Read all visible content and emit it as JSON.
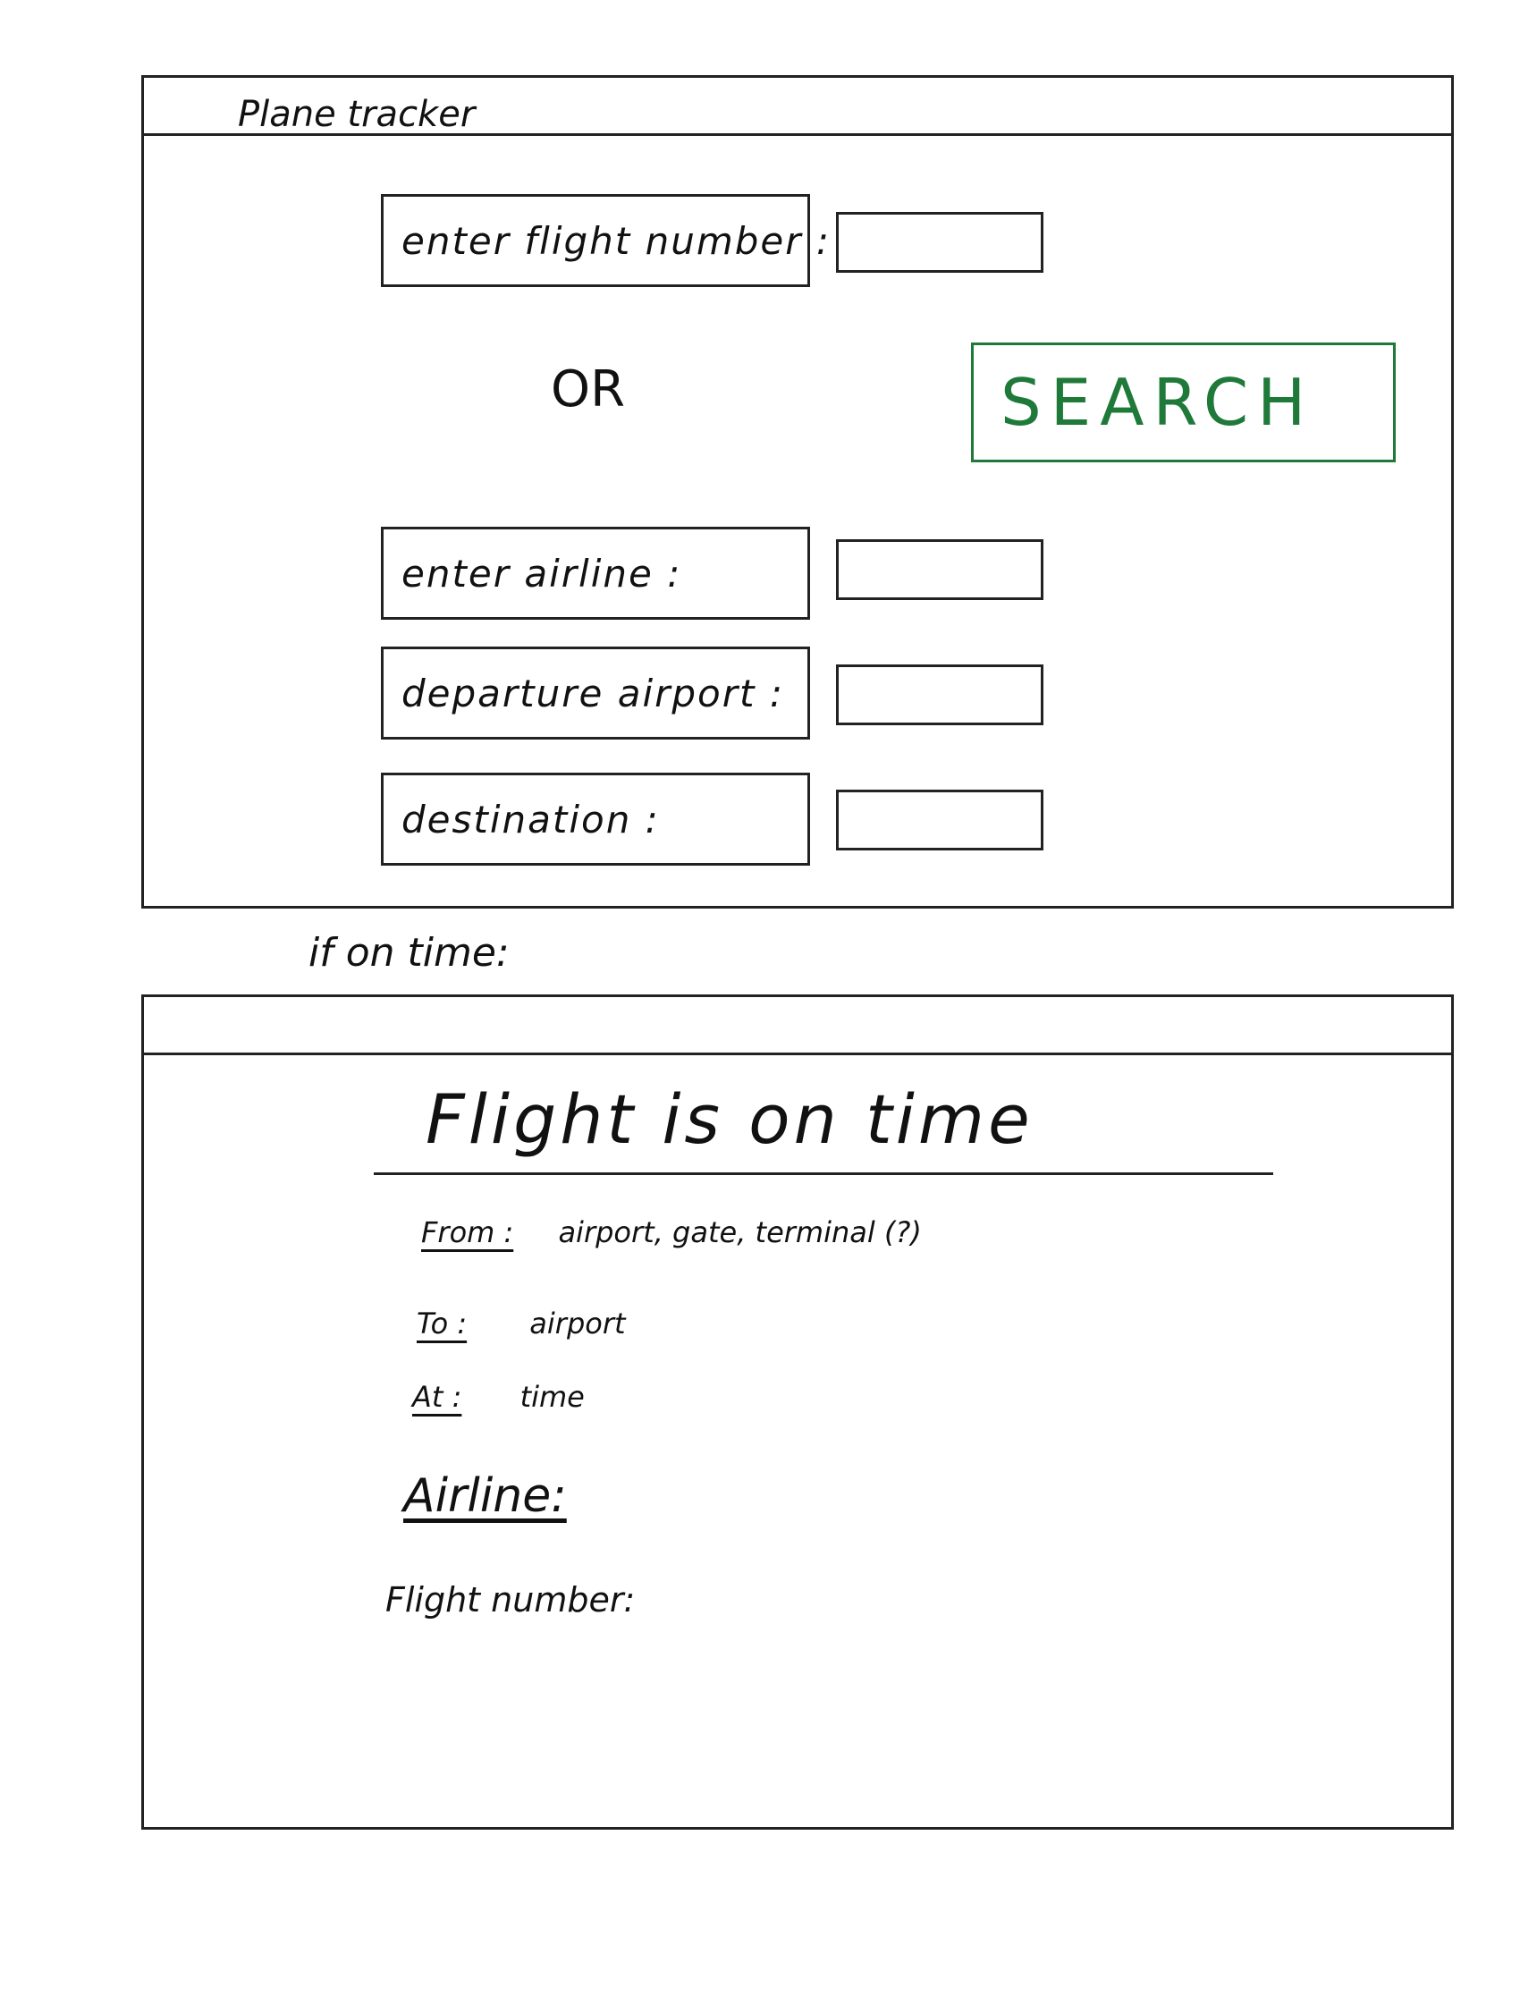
{
  "app": {
    "title": "Plane tracker"
  },
  "search_form": {
    "flight_number_label": "enter flight number :",
    "or_label": "OR",
    "search_button_label": "SEARCH",
    "airline_label": "enter airline :",
    "departure_label": "departure airport :",
    "destination_label": "destination :",
    "flight_number_value": "",
    "airline_value": "",
    "departure_value": "",
    "destination_value": ""
  },
  "transition_note": "if on time:",
  "result": {
    "heading": "Flight is on time",
    "from_label": "From :",
    "from_value": "airport, gate, terminal (?)",
    "to_label": "To :",
    "to_value": "airport",
    "at_label": "At :",
    "at_value": "time",
    "airline_label": "Airline:",
    "flight_number_label": "Flight number:"
  },
  "colors": {
    "search_accent": "#1f7a3a",
    "ink": "#222222"
  }
}
